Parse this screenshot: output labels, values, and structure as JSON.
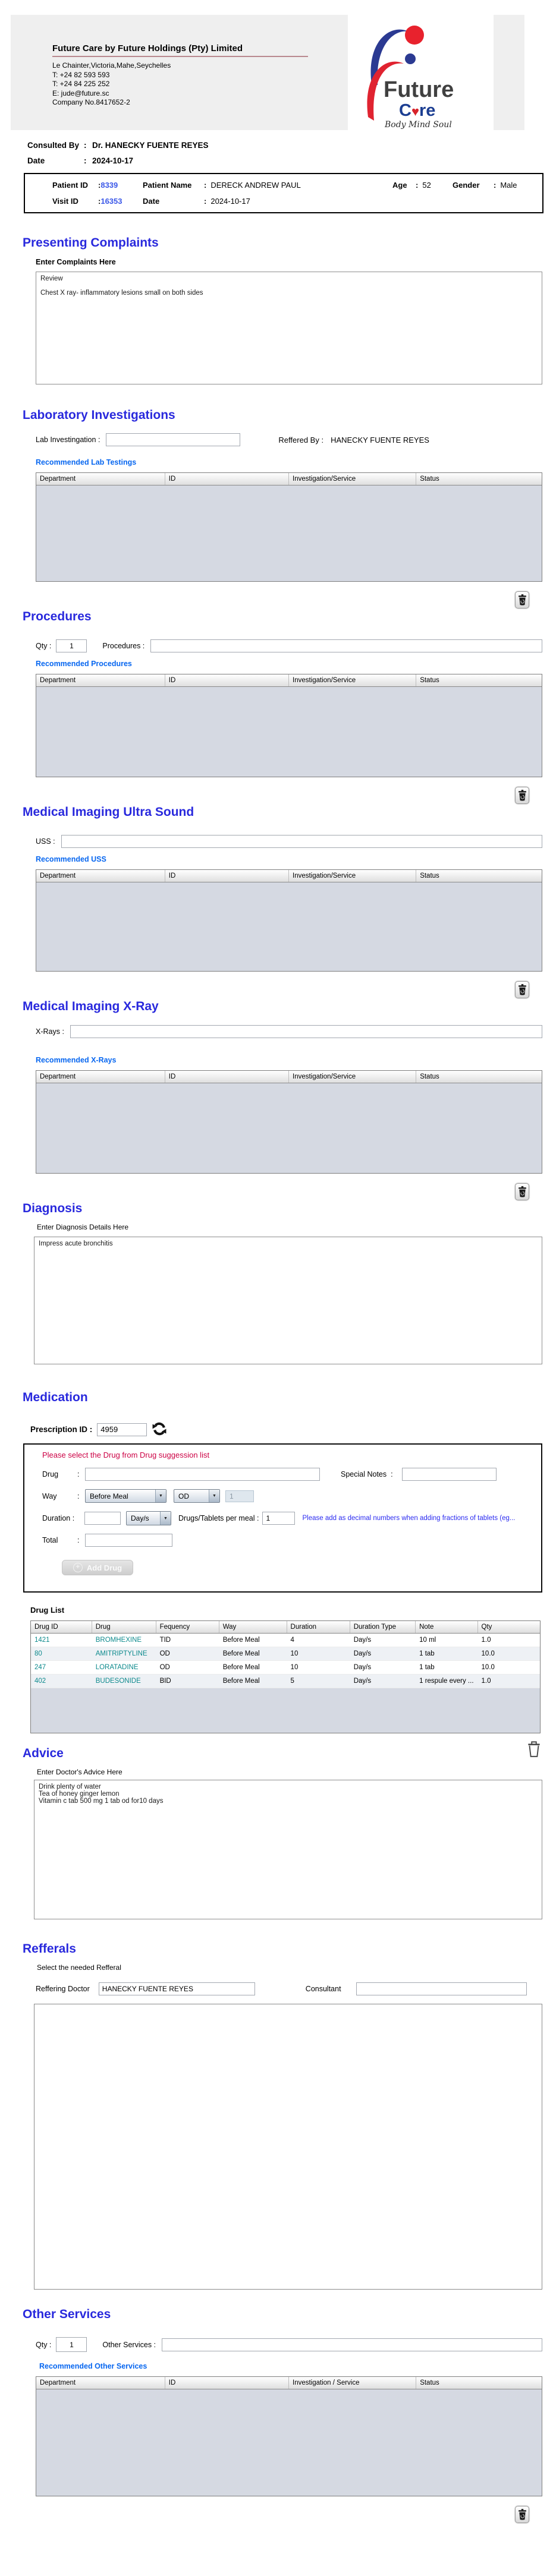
{
  "ui": {
    "colon": ":"
  },
  "colors": {
    "accent_blue": "#2929dd",
    "link_blue": "#0666f0",
    "alert_red": "#cc0044",
    "note_blue": "#2a2af0",
    "teal": "#0d8a8d"
  },
  "header": {
    "company_title": "Future Care by Future Holdings (Pty) Limited",
    "address_lines": {
      "0": "Le Chainter,Victoria,Mahe,Seychelles",
      "1": "T: +24  82 593 593",
      "2": "T: +24  84 225 252",
      "3": "E: jude@future.sc",
      "4": "Company No.8417652-2"
    },
    "logo": {
      "brand": "Future",
      "care_c": "C",
      "care_heart": "♥",
      "care_re": "re",
      "tagline": "Body Mind Soul"
    }
  },
  "consultation": {
    "consulted_by_label": "Consulted By",
    "consulted_by_value": "Dr.  HANECKY FUENTE REYES",
    "date_label": "Date",
    "date_value": "2024-10-17"
  },
  "patient": {
    "id_label": "Patient ID",
    "id_value": "8339",
    "name_label": "Patient Name",
    "name_value": "DERECK ANDREW PAUL",
    "age_label": "Age",
    "age_value": "52",
    "gender_label": "Gender",
    "gender_value": "Male",
    "visit_label": "Visit ID",
    "visit_value": "16353",
    "date_label": "Date",
    "date_value": "2024-10-17"
  },
  "complaints": {
    "title": "Presenting Complaints",
    "label": "Enter Complaints Here",
    "value": "Review\n\nChest X ray- inflammatory lesions small on both sides"
  },
  "laboratory": {
    "title": "Laboratory  Investigations",
    "lab_label": "Lab Investingation :",
    "referred_label": "Reffered By :",
    "referred_value": "HANECKY FUENTE REYES",
    "recommended": "Recommended Lab Testings",
    "headers": {
      "0": "Department",
      "1": "ID",
      "2": "Investigation/Service",
      "3": "Status"
    }
  },
  "procedures": {
    "title": "Procedures",
    "qty_label": "Qty :",
    "qty_value": "1",
    "label": "Procedures :",
    "recommended": "Recommended Procedures",
    "headers": {
      "0": "Department",
      "1": "ID",
      "2": "Investigation/Service",
      "3": "Status"
    }
  },
  "uss": {
    "title": "Medical Imaging Ultra Sound",
    "label": "USS :",
    "recommended": "Recommended USS",
    "headers": {
      "0": "Department",
      "1": "ID",
      "2": "Investigation/Service",
      "3": "Status"
    }
  },
  "xray": {
    "title": "Medical Imaging X-Ray",
    "label": "X-Rays :",
    "recommended": "Recommended X-Rays",
    "headers": {
      "0": "Department",
      "1": "ID",
      "2": "Investigation/Service",
      "3": "Status"
    }
  },
  "diagnosis": {
    "title": "Diagnosis",
    "label": "Enter Diagnosis Details Here",
    "value": "Impress acute bronchitis"
  },
  "medication": {
    "title": "Medication",
    "prescription_label": "Prescription ID :",
    "prescription_value": "4959",
    "hint": "Please select the Drug from Drug suggession list",
    "drug_label": "Drug",
    "special_label": "Special Notes",
    "way_label": "Way",
    "way_value": "Before Meal",
    "freq_value": "OD",
    "freq_qty": "1",
    "duration_label": "Duration :",
    "duration_value": "",
    "duration_unit": "Day/s",
    "per_meal_label": "Drugs/Tablets per meal :",
    "per_meal_value": "1",
    "fraction_note": "Please add as decimal numbers when adding fractions of tablets (eg...",
    "total_label": "Total",
    "add_drug_label": "Add Drug",
    "drug_list_label": "Drug List",
    "drug_headers": {
      "0": "Drug ID",
      "1": "Drug",
      "2": "Fequency",
      "3": "Way",
      "4": "Duration",
      "5": "Duration Type",
      "6": "Note",
      "7": "Qty"
    },
    "drug_rows": [
      [
        "1421",
        "BROMHEXINE",
        "TID",
        "Before Meal",
        "4",
        "Day/s",
        "10 ml",
        "1.0"
      ],
      [
        "80",
        "AMITRIPTYLINE",
        "OD",
        "Before Meal",
        "10",
        "Day/s",
        "1 tab",
        "10.0"
      ],
      [
        "247",
        "LORATADINE",
        "OD",
        "Before Meal",
        "10",
        "Day/s",
        "1 tab",
        "10.0"
      ],
      [
        "402",
        "BUDESONIDE",
        "BID",
        "Before Meal",
        "5",
        "Day/s",
        "1 respule every ...",
        "1.0"
      ]
    ]
  },
  "advice": {
    "title": "Advice",
    "label": "Enter Doctor's Advice Here",
    "value": "Drink plenty of water\nTea of honey ginger lemon\nVitamin c tab 500 mg 1 tab od for10 days"
  },
  "referrals": {
    "title": "Refferals",
    "label": "Select the needed Refferal",
    "doctor_label": "Reffering Doctor",
    "doctor_value": "HANECKY FUENTE REYES",
    "consultant_label": "Consultant",
    "consultant_value": ""
  },
  "other": {
    "title": "Other Services",
    "qty_label": "Qty :",
    "qty_value": "1",
    "label": "Other Services :",
    "recommended": "Recommended Other Services",
    "headers": {
      "0": "Department",
      "1": "ID",
      "2": "Investigation / Service",
      "3": "Status"
    }
  }
}
